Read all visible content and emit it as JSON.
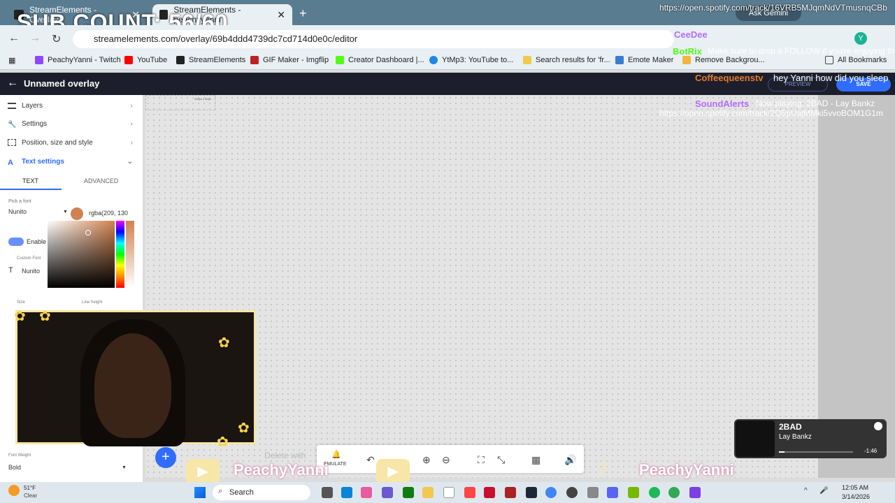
{
  "overlay": {
    "sub_count": "SUB COUNT: 56/60"
  },
  "tabs": [
    {
      "title": "StreamElements - Overlays"
    },
    {
      "title": "StreamElements - peachyyanni"
    }
  ],
  "address": {
    "url": "streamelements.com/overlay/69b4ddd4739dc7cd714d0e0c/editor"
  },
  "bookmarks": [
    "PeachyYanni - Twitch",
    "YouTube",
    "StreamElements",
    "GIF Maker - Imgflip",
    "Creator Dashboard |...",
    "YtMp3: YouTube to...",
    "Search results for 'fr...",
    "Emote Maker",
    "Remove Backgrou...",
    "All Bookmarks"
  ],
  "editor": {
    "title": "Unnamed overlay",
    "preview": "PREVIEW",
    "save": "SAVE"
  },
  "panel": {
    "items": [
      "Layers",
      "Settings",
      "Position, size and style",
      "Text settings"
    ],
    "tabs": [
      "TEXT",
      "ADVANCED"
    ],
    "pick_font_label": "Pick a font",
    "font": "Nunito",
    "color_value": "rgba(209, 130",
    "enable_label": "Enable",
    "custom_font_label": "Custom Font",
    "custom_font": "Nunito",
    "size_label": "Size",
    "line_height_label": "Line height",
    "font_weight_label": "Font Weight",
    "font_weight": "Bold",
    "delete_hint": "Delete with"
  },
  "canvas": {
    "widget_label": "200px x 50px"
  },
  "toolbar": {
    "emulate": "EMULATE"
  },
  "chat": [
    {
      "user": "",
      "text": "https://open.spotify.com/track/16VRB5MJqmNdVTmusnqCBb"
    },
    {
      "user": "CeeDee",
      "text": ""
    },
    {
      "user": "BotRix",
      "text": "Make sure to drop a FOLLOW if you're enjoying the stream!"
    },
    {
      "user": "Coffeequeenstv",
      "text": "hey Yanni how did you sleep"
    },
    {
      "user": "SoundAlerts",
      "text": "Now playing: 2BAD - Lay Bankz https://open.spotify.com/track/2Q5pUajMMki5vvoBOM1G1m"
    }
  ],
  "browser_ui": {
    "ask_gemini": "Ask Gemini"
  },
  "music": {
    "track": "2BAD",
    "artist": "Lay Bankz",
    "time": "-1:46"
  },
  "banner": {
    "name1": "PeachyYanni",
    "name2": "PeachyYanni"
  },
  "taskbar": {
    "weather_temp": "51°F",
    "weather_desc": "Clear",
    "search": "Search",
    "time": "12:05 AM",
    "date": "3/14/2026"
  }
}
